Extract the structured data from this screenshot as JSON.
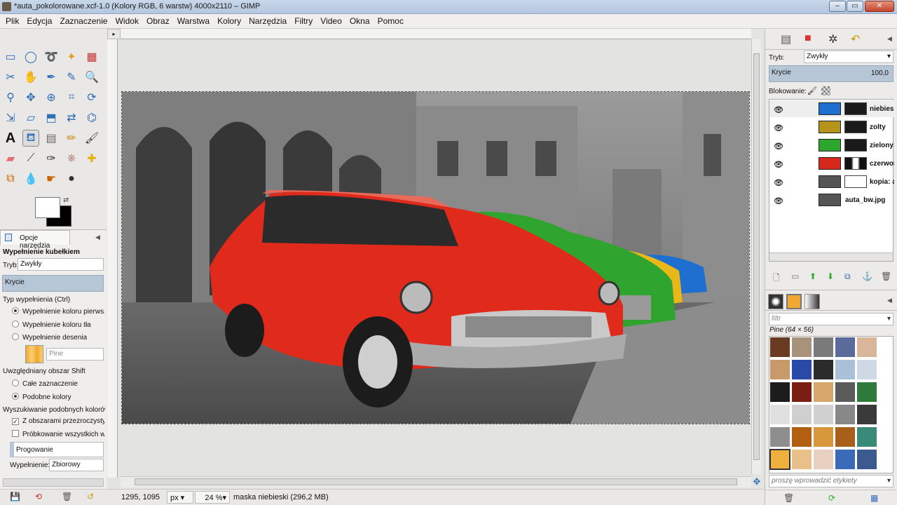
{
  "window": {
    "title": "*auta_pokolorowane.xcf-1.0 (Kolory RGB, 6 warstw) 4000x2110 – GIMP",
    "buttons": [
      "–",
      "▭",
      "✕"
    ]
  },
  "menu": [
    "Plik",
    "Edycja",
    "Zaznaczenie",
    "Widok",
    "Obraz",
    "Warstwa",
    "Kolory",
    "Narzędzia",
    "Filtry",
    "Video",
    "Okna",
    "Pomoc"
  ],
  "tool_options": {
    "tab": "Opcje narzędzia",
    "tool_name": "Wypełnienie kubełkiem",
    "mode_label": "Tryb:",
    "mode_value": "Zwykły",
    "opacity_label": "Krycie",
    "fill_type_label": "Typ wypełnienia  (Ctrl)",
    "fill_fg": "Wypełnienie koloru pierwsz",
    "fill_bg": "Wypełnienie koloru tła",
    "fill_pattern": "Wypełnienie desenia",
    "pattern_name": "Pine",
    "area_label": "Uwzględniany obszar  Shift",
    "area_selection": "Całe zaznaczenie",
    "area_similar": "Podobne kolory",
    "similar_label": "Wyszukiwanie podobnych kolorów",
    "transparent": "Z obszarami przezroczystym",
    "sample_merged": "Próbkowanie wszystkich wa",
    "threshold": "Progowanie",
    "fill_by_label": "Wypełnienie:",
    "fill_by_value": "Zbiorowy"
  },
  "status": {
    "coords": "1295, 1095",
    "unit": "px",
    "zoom": "24 %",
    "message": "maska niebieski (296,2 MB)"
  },
  "layers_panel": {
    "mode_label": "Tryb:",
    "mode_value": "Zwykły",
    "opacity_label": "Krycie",
    "opacity_value": "100,0",
    "lock_label": "Blokowanie:",
    "layers": [
      {
        "name": "niebieski",
        "color": "#1f6fd0",
        "mask": "dark"
      },
      {
        "name": "zolty",
        "color": "#b5941a",
        "mask": "dark"
      },
      {
        "name": "zielony",
        "color": "#2ea62e",
        "mask": "dark"
      },
      {
        "name": "czerwony",
        "color": "#d8281c",
        "mask": "car"
      },
      {
        "name": "kopia: auta_bw.jpg",
        "color": "#555555",
        "mask": "white"
      },
      {
        "name": "auta_bw.jpg",
        "color": "#555555",
        "mask": "none"
      }
    ]
  },
  "patterns_panel": {
    "filter_placeholder": "filtr",
    "selected": "Pine (64 × 56)",
    "tag_placeholder": "proszę wprowadzić etykiety",
    "colors": [
      "#6b3a22",
      "#a8927a",
      "#7a7a7a",
      "#5a6a9a",
      "#d9b59a",
      "#c89a6a",
      "#2a4aa8",
      "#2b2b2b",
      "#a9c0d8",
      "#cfd9e6",
      "#1c1c1c",
      "#7a1e14",
      "#d6a76a",
      "#5a5a5a",
      "#2f7a3a",
      "#e0e0e0",
      "#cfcfcf",
      "#d0d0d0",
      "#888888",
      "#3a3a3a",
      "#8e8e8e",
      "#b35f12",
      "#d8973a",
      "#a85f1a",
      "#3a8a7a",
      "#f0b040",
      "#e8c08a",
      "#e8d0c0",
      "#3a6ab8",
      "#3a5a90"
    ]
  }
}
